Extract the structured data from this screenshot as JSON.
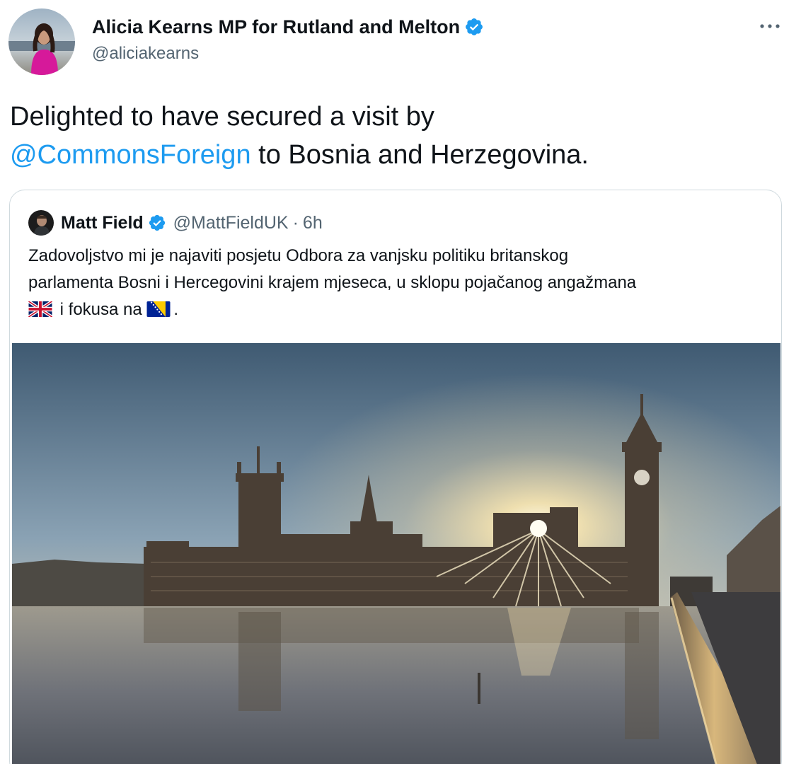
{
  "author": {
    "name": "Alicia Kearns MP for Rutland and Melton",
    "handle": "@aliciakearns",
    "verified": true
  },
  "tweet": {
    "text_line1": "Delighted to have secured a visit by",
    "mention": "@CommonsForeign",
    "text_line2_rest": " to Bosnia and Herzegovina."
  },
  "quoted": {
    "name": "Matt Field",
    "handle": "@MattFieldUK",
    "separator": "·",
    "time": "6h",
    "text_line1": "Zadovoljstvo mi je najaviti posjetu Odbora za vanjsku politiku britanskog",
    "text_line2": "parlamenta Bosni i Hercegovini krajem mjeseca, u sklopu pojačanog angažmana",
    "text_line3_mid": " i fokusa na ",
    "text_line3_end": ".",
    "flags": [
      "uk-flag-icon",
      "bosnia-flag-icon"
    ]
  },
  "colors": {
    "accent": "#1d9bf0",
    "text": "#0f1419",
    "secondary": "#536471",
    "border": "#cfd9de"
  },
  "icons": {
    "verified": "verified-badge-icon",
    "more": "more-options-icon"
  }
}
